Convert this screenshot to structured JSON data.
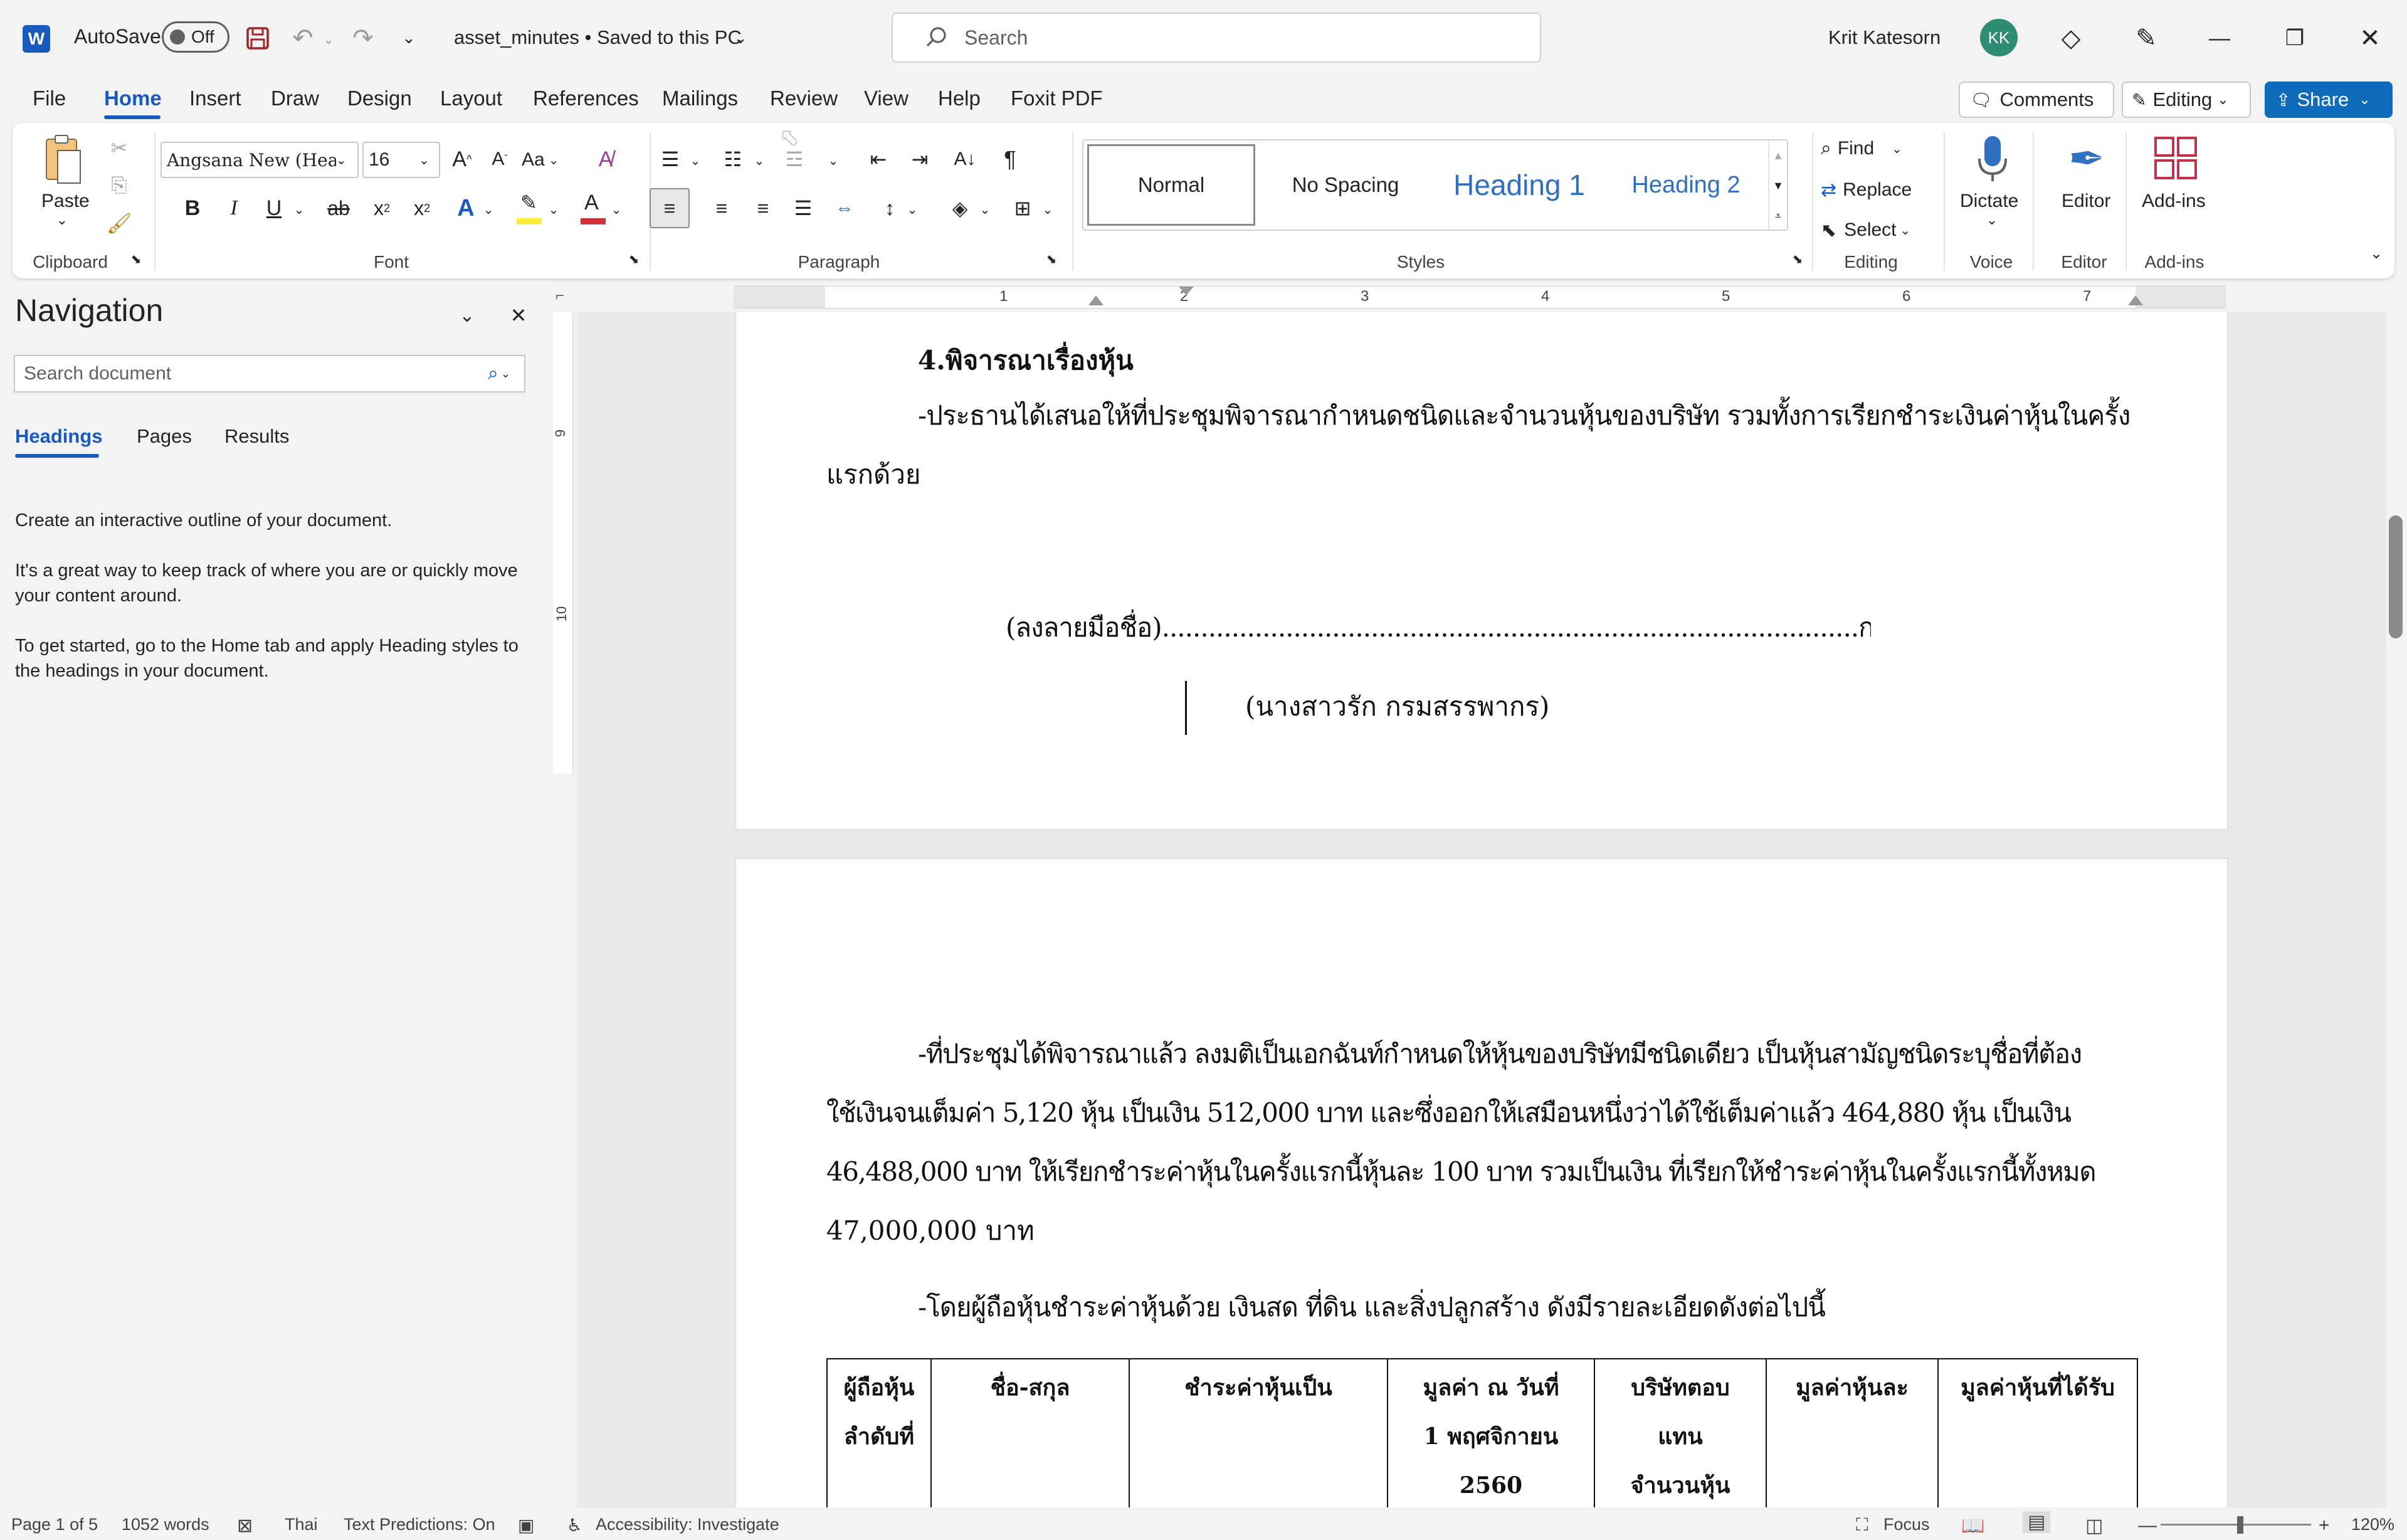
{
  "titlebar": {
    "autosave_label": "AutoSave",
    "autosave_state": "Off",
    "doc_title": "asset_minutes • Saved to this PC",
    "search_placeholder": "Search",
    "user_name": "Krit Katesorn",
    "user_initials": "KK"
  },
  "menu": {
    "tabs": [
      "File",
      "Home",
      "Insert",
      "Draw",
      "Design",
      "Layout",
      "References",
      "Mailings",
      "Review",
      "View",
      "Help",
      "Foxit PDF"
    ],
    "comments": "Comments",
    "editing": "Editing",
    "share": "Share"
  },
  "ribbon": {
    "paste": "Paste",
    "font_name": "Angsana New (Headi",
    "font_size": "16",
    "change_case": "Aa",
    "styles": [
      "Normal",
      "No Spacing",
      "Heading 1",
      "Heading 2"
    ],
    "find": "Find",
    "replace": "Replace",
    "select": "Select",
    "dictate": "Dictate",
    "editor": "Editor",
    "addins": "Add-ins",
    "groups": {
      "clipboard": "Clipboard",
      "font": "Font",
      "paragraph": "Paragraph",
      "styles": "Styles",
      "editing": "Editing",
      "voice": "Voice",
      "editor": "Editor",
      "addins": "Add-ins"
    }
  },
  "ruler": {
    "ticks": [
      "1",
      "2",
      "3",
      "4",
      "5",
      "6",
      "7"
    ],
    "vticks": [
      "9",
      "10"
    ]
  },
  "navigation": {
    "title": "Navigation",
    "search_placeholder": "Search document",
    "tabs": [
      "Headings",
      "Pages",
      "Results"
    ],
    "help1": "Create an interactive outline of your document.",
    "help2": "It's a great way to keep track of where you are or quickly move your content around.",
    "help3": "To get started, go to the Home tab and apply Heading styles to the headings in your document."
  },
  "document": {
    "page1": {
      "heading": "4.พิจารณาเรื่องหุ้น",
      "para_line1": "-ประธานได้เสนอให้ที่ประชุมพิจารณากำหนดชนิดและจำนวนหุ้นของบริษัท รวมทั้งการเรียกชำระเงินค่าหุ้นในครั้ง",
      "para_line2": "แรกด้วย",
      "signature": "(ลงลายมือชื่อ)..........................................................................................กรรมการ",
      "signer": "(นางสาวรัก กรมสรรพากร)"
    },
    "page2": {
      "line1": "-ที่ประชุมได้พิจารณาแล้ว ลงมติเป็นเอกฉันท์กำหนดให้หุ้นของบริษัทมีชนิดเดียว เป็นหุ้นสามัญชนิดระบุชื่อที่ต้อง",
      "line2": "ใช้เงินจนเต็มค่า 5,120 หุ้น เป็นเงิน 512,000 บาท และซึ่งออกให้เสมือนหนึ่งว่าได้ใช้เต็มค่าแล้ว 464,880 หุ้น เป็นเงิน",
      "line3": "46,488,000 บาท ให้เรียกชำระค่าหุ้นในครั้งแรกนี้หุ้นละ 100 บาท รวมเป็นเงิน ที่เรียกให้ชำระค่าหุ้นในครั้งแรกนี้ทั้งหมด",
      "line4": "47,000,000 บาท",
      "line5": "-โดยผู้ถือหุ้นชำระค่าหุ้นด้วย เงินสด ที่ดิน และสิ่งปลูกสร้าง ดังมีรายละเอียดดังต่อไปนี้",
      "table_headers": [
        [
          "ผู้ถือหุ้น",
          "ลำดับที่"
        ],
        [
          "ชื่อ-สกุล"
        ],
        [
          "ชำระค่าหุ้นเป็น"
        ],
        [
          "มูลค่า ณ วันที่",
          "1 พฤศจิกายน",
          "2560"
        ],
        [
          "บริษัทตอบ",
          "แทน",
          "จำนวนหุ้น"
        ],
        [
          "มูลค่าหุ้นละ"
        ],
        [
          "มูลค่าหุ้นที่ได้รับ"
        ]
      ]
    }
  },
  "status": {
    "page": "Page 1 of 5",
    "words": "1052 words",
    "language": "Thai",
    "predictions": "Text Predictions: On",
    "accessibility": "Accessibility: Investigate",
    "focus": "Focus",
    "zoom": "120%"
  },
  "colors": {
    "accent": "#185abd",
    "share": "#0f6cbd"
  }
}
